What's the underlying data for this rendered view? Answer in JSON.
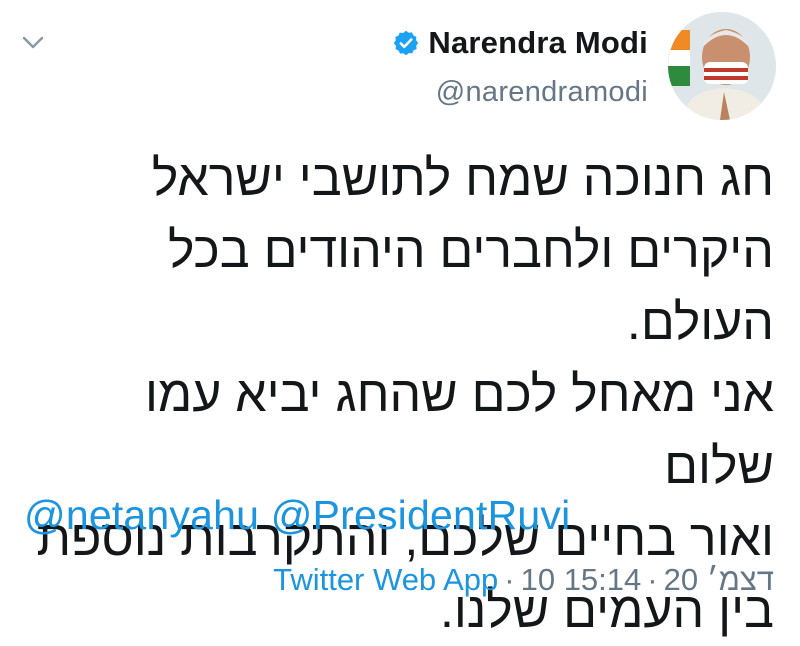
{
  "author": {
    "name": "Narendra Modi",
    "handle": "@narendramodi",
    "verified": true
  },
  "tweet": {
    "lines": [
      "חג חנוכה שמח לתושבי ישראל",
      "היקרים ולחברים היהודים בכל העולם.",
      "אני מאחל לכם שהחג יביא עמו שלום",
      "ואור בחיים שלכם, והתקרבות נוספת",
      "בין העמים שלנו."
    ],
    "mentions": [
      "@netanyahu",
      "@PresidentRuvi"
    ]
  },
  "meta": {
    "time": "15:14",
    "date": "10 דצמ׳ 20",
    "source": "Twitter Web App",
    "separator": "·"
  },
  "icons": {
    "more": "chevron-down-icon",
    "verified": "verified-badge-icon"
  },
  "colors": {
    "link": "#1b95e0",
    "muted": "#657786",
    "text": "#14171a",
    "verified": "#1da1f2"
  }
}
